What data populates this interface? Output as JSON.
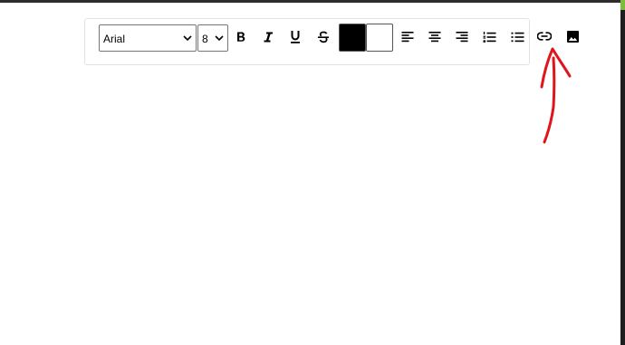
{
  "toolbar": {
    "font_family_value": "Arial",
    "font_size_value": "8",
    "buttons": [
      {
        "name": "bold-button",
        "icon": "bold-icon"
      },
      {
        "name": "italic-button",
        "icon": "italic-icon"
      },
      {
        "name": "underline-button",
        "icon": "underline-icon"
      },
      {
        "name": "strikethrough-button",
        "icon": "strikethrough-icon"
      },
      {
        "name": "align-left-button",
        "icon": "align-left-icon"
      },
      {
        "name": "align-center-button",
        "icon": "align-center-icon"
      },
      {
        "name": "align-right-button",
        "icon": "align-right-icon"
      },
      {
        "name": "ordered-list-button",
        "icon": "ordered-list-icon"
      },
      {
        "name": "bullet-list-button",
        "icon": "bullet-list-icon"
      }
    ],
    "text_color": "#000000",
    "background_color": "#ffffff"
  },
  "extra_buttons": [
    {
      "name": "insert-link-button",
      "icon": "link-icon"
    },
    {
      "name": "insert-image-button",
      "icon": "image-icon"
    }
  ],
  "annotation": {
    "type": "hand-drawn-arrow",
    "color": "#e0151b",
    "points_to": "insert-link-button"
  }
}
